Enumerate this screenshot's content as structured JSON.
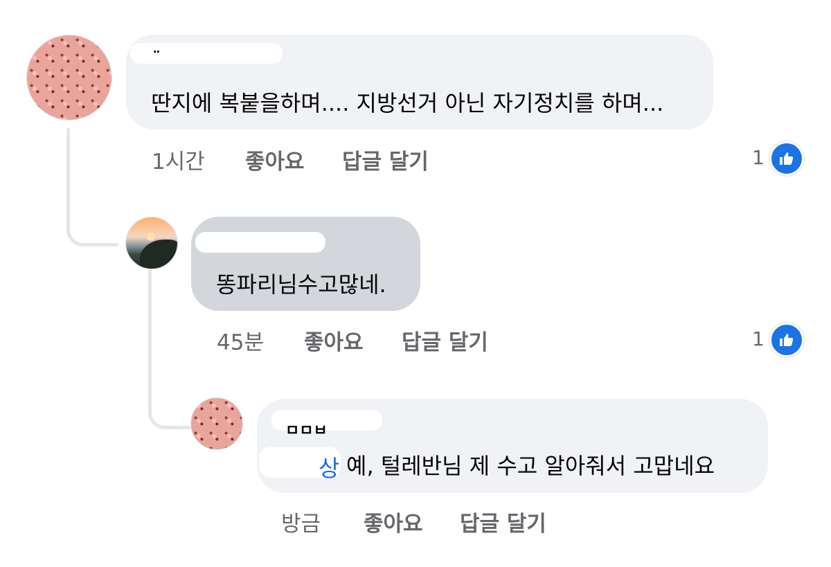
{
  "comments": [
    {
      "name_visible_fragment": "¨",
      "text": "딴지에 복붙을하며.... 지방선거 아닌 자기정치를 하며...",
      "time": "1시간",
      "like_label": "좋아요",
      "reply_label": "답글 달기",
      "reaction_count": "1",
      "reaction_icon": "thumbs-up-icon"
    },
    {
      "text": "똥파리님수고많네.",
      "time": "45분",
      "like_label": "좋아요",
      "reply_label": "답글 달기",
      "reaction_count": "1",
      "reaction_icon": "thumbs-up-icon"
    },
    {
      "name_visible_fragment": "ㅁㅁㅂ",
      "mention_visible_fragment": "상",
      "text": "예, 털레반님 제 수고 알아줘서 고맙네요",
      "time": "방금",
      "like_label": "좋아요",
      "reply_label": "답글 달기"
    }
  ],
  "colors": {
    "bubble": "#f0f2f5",
    "bubble_highlighted": "#d3d6db",
    "meta_text": "#65676b",
    "mention": "#216fdb",
    "like_badge": "#1b74e4",
    "thread_line": "#e4e6eb"
  }
}
